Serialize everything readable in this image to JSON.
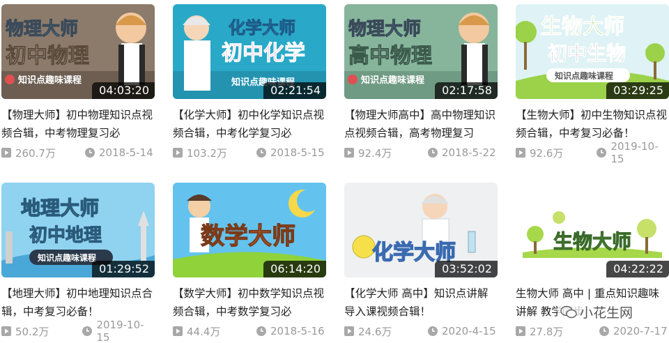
{
  "videos": [
    {
      "title": "【物理大师】初中物理知识点视频合辑，中考物理复习必",
      "duration": "04:03:20",
      "views": "260.7万",
      "date": "2018-5-14",
      "thumb_lines": [
        "物理大师",
        "初中物理",
        "知识点趣味课程"
      ]
    },
    {
      "title": "【化学大师】初中化学知识点视频合辑，中考化学复习必",
      "duration": "02:21:54",
      "views": "103.2万",
      "date": "2018-5-15",
      "thumb_lines": [
        "化学大师",
        "初中化学",
        "知识点趣味课程"
      ]
    },
    {
      "title": "【物理大师高中】高中物理知识点视频合辑，高考物理复习",
      "duration": "02:17:58",
      "views": "92.4万",
      "date": "2018-5-22",
      "thumb_lines": [
        "物理大师",
        "高中物理",
        "知识点趣味课程"
      ]
    },
    {
      "title": "【生物大师】初中生物知识点视频合辑，中考复习必备！",
      "duration": "03:29:25",
      "views": "92.6万",
      "date": "2019-10-15",
      "thumb_lines": [
        "生物大师",
        "初中生物",
        "知识点趣味课程"
      ]
    },
    {
      "title": "【地理大师】初中地理知识点合辑，中考复习必备！",
      "duration": "01:29:52",
      "views": "50.2万",
      "date": "2019-10-15",
      "thumb_lines": [
        "地理大师",
        "初中地理",
        "知识点趣味课程"
      ]
    },
    {
      "title": "【数学大师】初中数学知识点视频合辑，中考数学复习必",
      "duration": "06:14:20",
      "views": "44.4万",
      "date": "2018-5-16",
      "thumb_lines": [
        "数学大师"
      ]
    },
    {
      "title": "【化学大师 高中】知识点讲解导入课视频合辑！",
      "duration": "03:52:02",
      "views": "24.6万",
      "date": "2020-4-15",
      "thumb_lines": [
        "化学大师"
      ]
    },
    {
      "title": "生物大师 高中 | 重点知识趣味讲解 教学同步",
      "duration": "04:22:22",
      "views": "27.8万",
      "date": "2020-7-17",
      "thumb_lines": [
        "生物大师"
      ]
    }
  ],
  "watermark": "小花生网",
  "colors": {
    "meta_text": "#9a9a9a",
    "title_text": "#222222",
    "duration_bg": "#000000"
  }
}
